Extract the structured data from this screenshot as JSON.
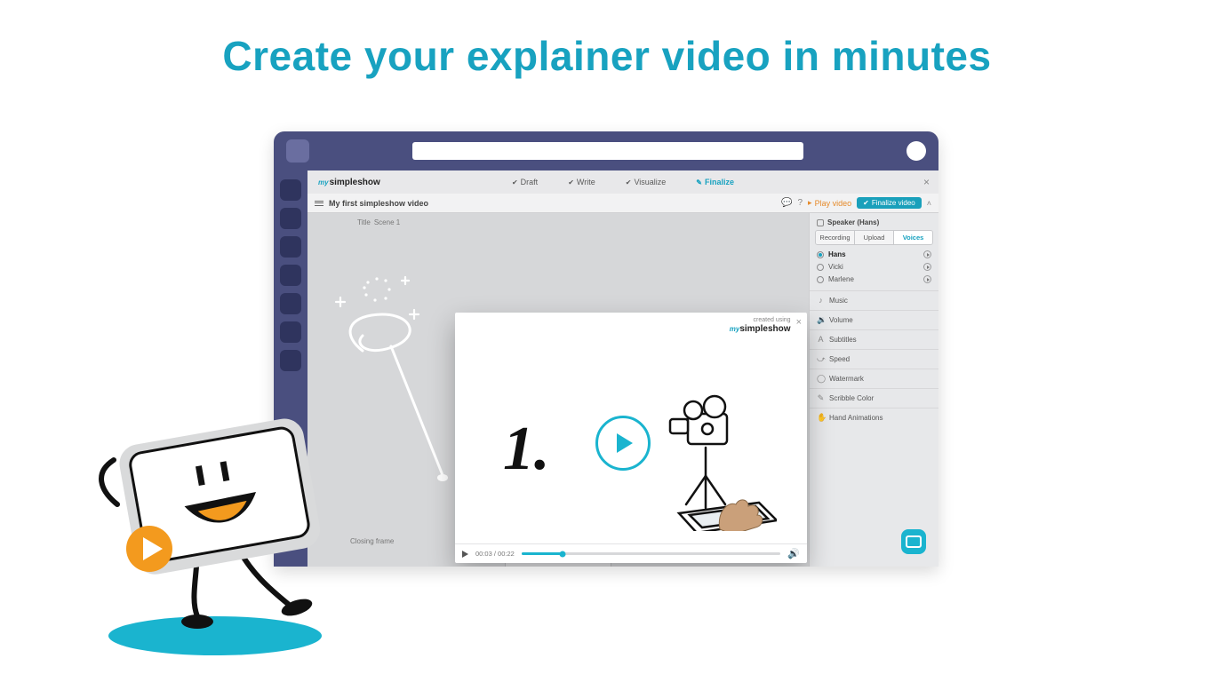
{
  "page": {
    "headline": "Create your explainer video in minutes"
  },
  "brand": {
    "prefix": "my",
    "name": "simpleshow"
  },
  "steps": [
    {
      "label": "Draft",
      "done": true
    },
    {
      "label": "Write",
      "done": true
    },
    {
      "label": "Visualize",
      "done": true
    },
    {
      "label": "Finalize",
      "active": true
    }
  ],
  "subbar": {
    "title": "My first simpleshow video",
    "play": "Play video",
    "finalize": "Finalize video"
  },
  "strip": {
    "title": "Title",
    "scene": "Scene 1",
    "closing": "Closing frame"
  },
  "panel": {
    "speaker": "Speaker (Hans)",
    "tabs": {
      "recording": "Recording",
      "upload": "Upload",
      "voices": "Voices"
    },
    "voices": [
      {
        "name": "Hans",
        "selected": true
      },
      {
        "name": "Vicki",
        "selected": false
      },
      {
        "name": "Marlene",
        "selected": false
      }
    ],
    "settings": {
      "music": "Music",
      "volume": "Volume",
      "subtitles": "Subtitles",
      "speed": "Speed",
      "watermark": "Watermark",
      "scribble": "Scribble Color",
      "hand": "Hand Animations"
    }
  },
  "modal": {
    "created_top": "created using",
    "brand_prefix": "my",
    "brand_name": "simpleshow",
    "step_number": "1",
    "time": "00:03 / 00:22"
  }
}
